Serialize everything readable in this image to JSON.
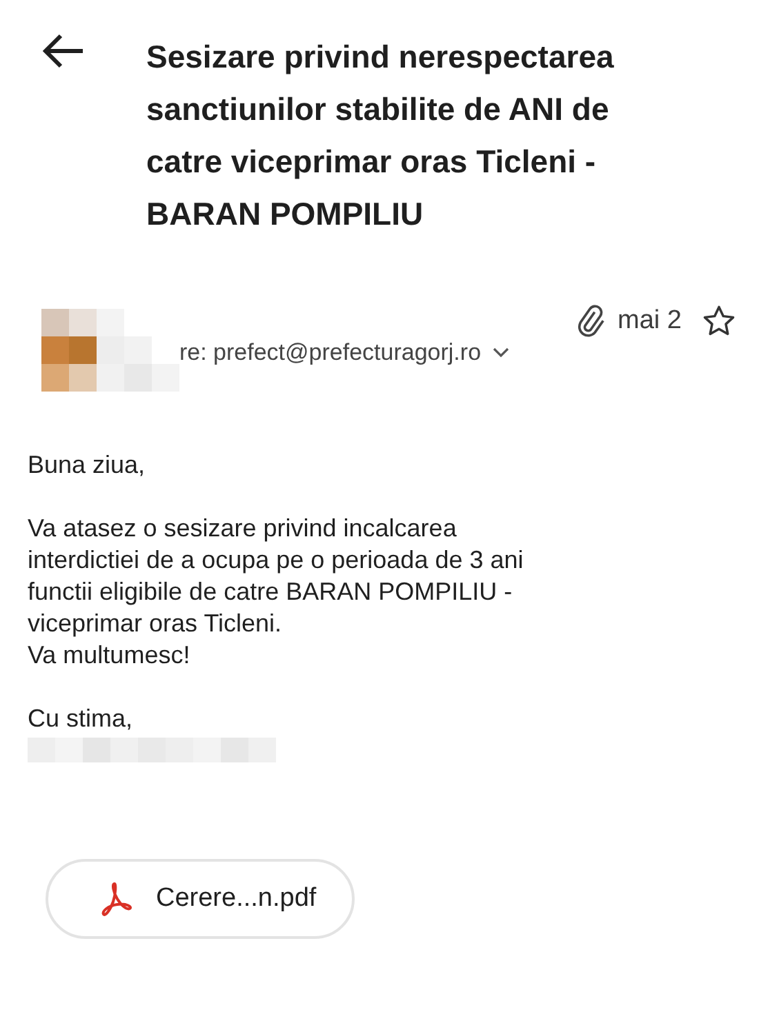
{
  "subject_lines": [
    "Sesizare privind nerespectarea",
    "sanctiunilor stabilite de ANI de",
    "catre viceprimar oras Ticleni -",
    "BARAN POMPILIU"
  ],
  "message": {
    "has_attachment": true,
    "date": "mai 2",
    "starred": false,
    "recipient": "re: prefect@prefecturagorj.ro"
  },
  "body": [
    [
      "Buna ziua,"
    ],
    [
      "Va atasez o sesizare privind incalcarea",
      "interdictiei de a ocupa pe o perioada de 3 ani",
      "functii eligibile de catre BARAN POMPILIU -",
      "viceprimar oras Ticleni.",
      "Va multumesc!"
    ],
    [
      "Cu stima,"
    ]
  ],
  "attachments": [
    {
      "kind": "pdf",
      "name": "Cerere...n.pdf"
    }
  ]
}
